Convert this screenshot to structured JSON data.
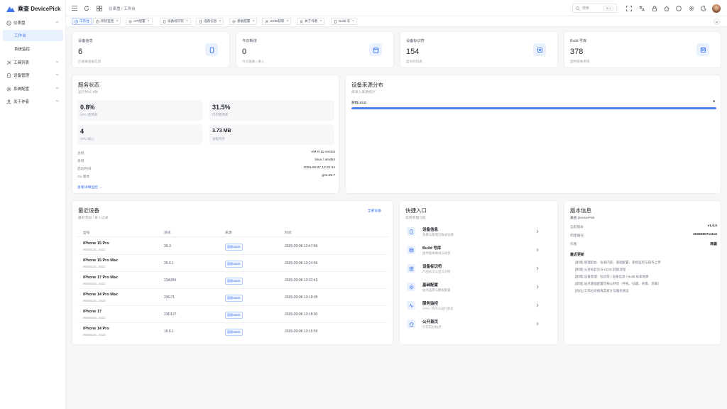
{
  "brand": {
    "name": "乘查 DevicePick",
    "accent": "#3b74ec"
  },
  "sidebar": {
    "items": [
      {
        "label": "仪表盘",
        "icon": "clock-icon",
        "expanded": true
      },
      {
        "label": "工作台",
        "active": true
      },
      {
        "label": "系统监控"
      },
      {
        "label": "工具列表",
        "icon": "tools-icon"
      },
      {
        "label": "设备管理",
        "icon": "phone-icon"
      },
      {
        "label": "系统配置",
        "icon": "gear-icon"
      },
      {
        "label": "关于作者",
        "icon": "user-icon"
      }
    ]
  },
  "topbar": {
    "breadcrumb": "仪表盘  /  工作台",
    "search": {
      "placeholder": "搜索",
      "shortcut": "⌘ K"
    }
  },
  "tabs": [
    {
      "label": "工作台",
      "icon": "clock-icon",
      "active": true
    },
    {
      "label": "系统监控",
      "icon": "clock-icon"
    },
    {
      "label": "API配置",
      "icon": "gear-icon"
    },
    {
      "label": "设备标识符",
      "icon": "phone-icon"
    },
    {
      "label": "设备信息",
      "icon": "phone-icon"
    },
    {
      "label": "基础配置",
      "icon": "gear-icon"
    },
    {
      "label": "UDID获取",
      "icon": "tools-icon"
    },
    {
      "label": "关于作者",
      "icon": "user-icon"
    },
    {
      "label": "Build 号",
      "icon": "phone-icon"
    }
  ],
  "stats": [
    {
      "label": "设备信息",
      "value": "6",
      "sub": "已收录设备信息",
      "icon": "phone-icon"
    },
    {
      "label": "今日新增",
      "value": "0",
      "sub": "今日设备 / 录入",
      "icon": "calendar-icon"
    },
    {
      "label": "设备标识符",
      "value": "154",
      "sub": "型号标识表",
      "icon": "chip-icon"
    },
    {
      "label": "Build 号库",
      "value": "378",
      "sub": "固件版本条目",
      "icon": "database-icon"
    }
  ],
  "service": {
    "title": "服务状态",
    "sub": "运行时长 5秒",
    "metrics": [
      {
        "value": "0.8%",
        "label": "CPU 使用率"
      },
      {
        "value": "31.5%",
        "label": "内存使用率"
      },
      {
        "value": "4",
        "label": "CPU 核心"
      },
      {
        "value": "3.73 MB",
        "label": "进程内存"
      }
    ],
    "info": [
      {
        "k": "主机",
        "v": "VM-0-11-centos"
      },
      {
        "k": "系统",
        "v": "linux / amd64"
      },
      {
        "k": "启动时间",
        "v": "2026-09-07 12:32:34"
      },
      {
        "k": "Go 版本",
        "v": "go1.26.7"
      }
    ],
    "link": "查看详细监控 →"
  },
  "distribution": {
    "title": "设备来源分布",
    "sub": "按录入来源统计",
    "items": [
      {
        "label": "获取UDID",
        "count": "6",
        "fraction": 1.0
      }
    ]
  },
  "recent": {
    "title": "最近设备",
    "sub": "最新添加 / 录入记录",
    "all_link": "全部设备",
    "headers": [
      "型号",
      "系统",
      "来源",
      "时间"
    ],
    "rows": [
      {
        "model": "iPhone 15 Pro",
        "serial": "00008130...401C",
        "sys": "26.3",
        "src": "获取UDID",
        "time": "2026-09-06 13:47:55"
      },
      {
        "model": "iPhone 15 Pro Max",
        "serial": "00008120...801C",
        "sys": "26.6.1",
        "src": "获取UDID",
        "time": "2026-09-06 13:24:56"
      },
      {
        "model": "iPhone 17 Pro Max",
        "serial": "00008150...401C",
        "sys": "23A355",
        "src": "获取UDID",
        "time": "2026-09-06 13:22:43"
      },
      {
        "model": "iPhone 14 Pro Max",
        "serial": "00008120...201E",
        "sys": "23G71",
        "src": "获取UDID",
        "time": "2026-09-06 13:19:35"
      },
      {
        "model": "iPhone 17",
        "serial": "00008150...401C",
        "sys": "23D127",
        "src": "获取UDID",
        "time": "2026-09-06 13:18:03"
      },
      {
        "model": "iPhone 14 Pro",
        "serial": "00008120...401E",
        "sys": "16.6.1",
        "src": "获取UDID",
        "time": "2026-09-06 13:15:59"
      }
    ]
  },
  "quick": {
    "title": "快捷入口",
    "sub": "常用管理功能",
    "items": [
      {
        "title": "设备信息",
        "sub": "查看与管理已收录设备",
        "icon": "phone-icon"
      },
      {
        "title": "Build 号库",
        "sub": "固件版本映射与同步",
        "icon": "database-icon"
      },
      {
        "title": "设备标识符",
        "sub": "产品标识与型号对照",
        "icon": "chip-icon"
      },
      {
        "title": "基础配置",
        "sub": "站点品牌与模板配置",
        "icon": "gear-icon"
      },
      {
        "title": "服务监控",
        "sub": "CPU / 内存与运行状态",
        "icon": "pulse-icon"
      },
      {
        "title": "公开首页",
        "sub": "打开前台站点",
        "icon": "home-icon"
      }
    ]
  },
  "version": {
    "title": "版本信息",
    "sub": "乘查 DevicePick",
    "info": [
      {
        "k": "当前版本",
        "v": "v1.0.0"
      },
      {
        "k": "构建编号",
        "v": "2026090711116"
      },
      {
        "k": "作者",
        "v": "网霞"
      }
    ],
    "changelog_title": "最近更新",
    "changelog": [
      "[新增] 管理后台、仪表内容、基础配置、系统监控与操作上传",
      "[新增] 公开站首页与 UDID 获取流程",
      "[新增] 设备管理：标识符 / 设备信息 / Build 号本地库",
      "[新增] 站点基础配置可按公开页（手机、标题、背景、页脚）",
      "[优化] 工作台对接真实统计与服务状态"
    ]
  }
}
